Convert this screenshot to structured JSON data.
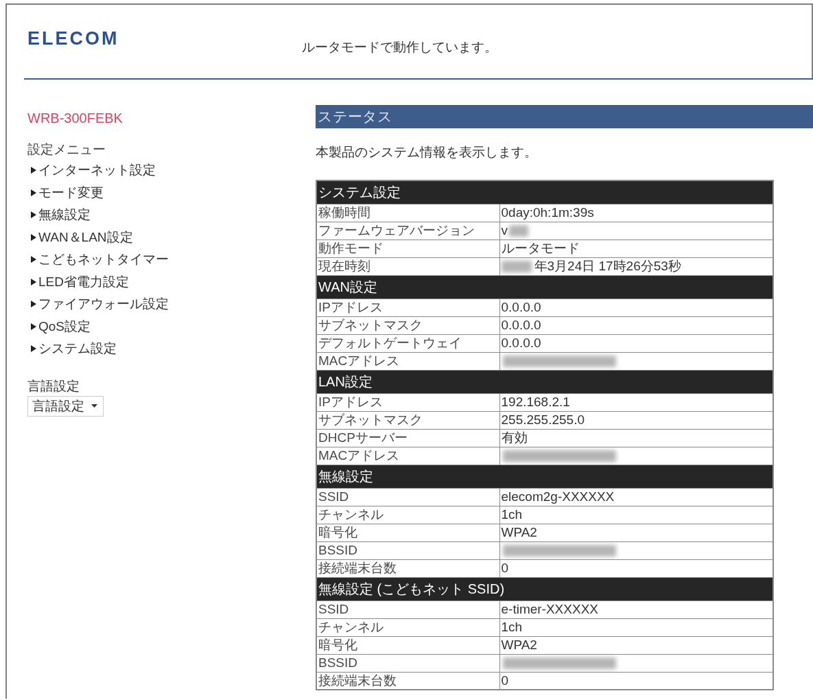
{
  "header": {
    "logo": "ELECOM",
    "mode_message": "ルータモードで動作しています。"
  },
  "sidebar": {
    "model": "WRB-300FEBK",
    "menu_title": "設定メニュー",
    "menu_items": [
      "インターネット設定",
      "モード変更",
      "無線設定",
      "WAN＆LAN設定",
      "こどもネットタイマー",
      "LED省電力設定",
      "ファイアウォール設定",
      "QoS設定",
      "システム設定"
    ],
    "language_label": "言語設定",
    "language_select": {
      "value": "言語設定"
    }
  },
  "main": {
    "title": "ステータス",
    "description": "本製品のシステム情報を表示します。",
    "sections": [
      {
        "title": "システム設定",
        "rows": [
          {
            "label": "稼働時間",
            "value": "0day:0h:1m:39s",
            "blur_before": false,
            "blur_after": false
          },
          {
            "label": "ファームウェアバージョン",
            "value": "v",
            "blur_before": false,
            "blur_after": true
          },
          {
            "label": "動作モード",
            "value": "ルータモード",
            "blur_before": false,
            "blur_after": false
          },
          {
            "label": "現在時刻",
            "value": "年3月24日 17時26分53秒",
            "blur_before": true,
            "blur_after": false
          }
        ]
      },
      {
        "title": "WAN設定",
        "rows": [
          {
            "label": "IPアドレス",
            "value": "0.0.0.0",
            "blur_before": false,
            "blur_after": false
          },
          {
            "label": "サブネットマスク",
            "value": "0.0.0.0",
            "blur_before": false,
            "blur_after": false
          },
          {
            "label": "デフォルトゲートウェイ",
            "value": "0.0.0.0",
            "blur_before": false,
            "blur_after": false
          },
          {
            "label": "MACアドレス",
            "blur_before": false,
            "blur_after": true
          }
        ]
      },
      {
        "title": "LAN設定",
        "rows": [
          {
            "label": "IPアドレス",
            "value": "192.168.2.1",
            "blur_before": false,
            "blur_after": false
          },
          {
            "label": "サブネットマスク",
            "value": "255.255.255.0",
            "blur_before": false,
            "blur_after": false
          },
          {
            "label": "DHCPサーバー",
            "value": "有効",
            "blur_before": false,
            "blur_after": false
          },
          {
            "label": "MACアドレス",
            "blur_before": false,
            "blur_after": true
          }
        ]
      },
      {
        "title": "無線設定",
        "rows": [
          {
            "label": "SSID",
            "value": "elecom2g-XXXXXX",
            "blur_before": false,
            "blur_after": false
          },
          {
            "label": "チャンネル",
            "value": "1ch",
            "blur_before": false,
            "blur_after": false
          },
          {
            "label": "暗号化",
            "value": "WPA2",
            "blur_before": false,
            "blur_after": false
          },
          {
            "label": "BSSID",
            "blur_before": false,
            "blur_after": true
          },
          {
            "label": "接続端末台数",
            "value": "0",
            "blur_before": false,
            "blur_after": false
          }
        ]
      },
      {
        "title": "無線設定 (こどもネット SSID)",
        "rows": [
          {
            "label": "SSID",
            "value": "e-timer-XXXXXX",
            "blur_before": false,
            "blur_after": false
          },
          {
            "label": "チャンネル",
            "value": "1ch",
            "blur_before": false,
            "blur_after": false
          },
          {
            "label": "暗号化",
            "value": "WPA2",
            "blur_before": false,
            "blur_after": false
          },
          {
            "label": "BSSID",
            "blur_before": false,
            "blur_after": true
          },
          {
            "label": "接続端末台数",
            "value": "0",
            "blur_before": false,
            "blur_after": false
          }
        ]
      }
    ]
  }
}
